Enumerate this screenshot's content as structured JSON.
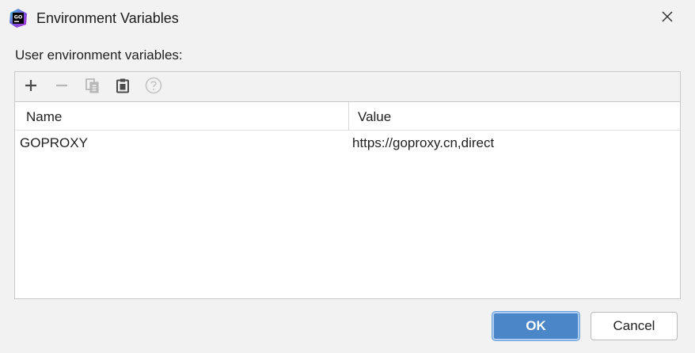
{
  "window": {
    "title": "Environment Variables",
    "app_icon_text": "GO",
    "app_icon_colors": [
      "#3bcdd2",
      "#7b4fe0",
      "#b43ad0"
    ]
  },
  "section": {
    "label": "User environment variables:"
  },
  "toolbar": {
    "buttons": [
      {
        "name": "add",
        "icon": "plus-icon",
        "enabled": true
      },
      {
        "name": "remove",
        "icon": "minus-icon",
        "enabled": false
      },
      {
        "name": "copy",
        "icon": "copy-icon",
        "enabled": false
      },
      {
        "name": "paste",
        "icon": "paste-icon",
        "enabled": true
      },
      {
        "name": "help",
        "icon": "help-icon",
        "enabled": false
      }
    ]
  },
  "table": {
    "columns": [
      "Name",
      "Value"
    ],
    "rows": [
      {
        "name": "GOPROXY",
        "value": "https://goproxy.cn,direct"
      }
    ]
  },
  "buttons": {
    "ok": "OK",
    "cancel": "Cancel"
  },
  "colors": {
    "accent": "#4a86c8",
    "background": "#f2f2f2",
    "disabled_icon": "#b8b8b8",
    "enabled_icon": "#4a4a4a"
  }
}
